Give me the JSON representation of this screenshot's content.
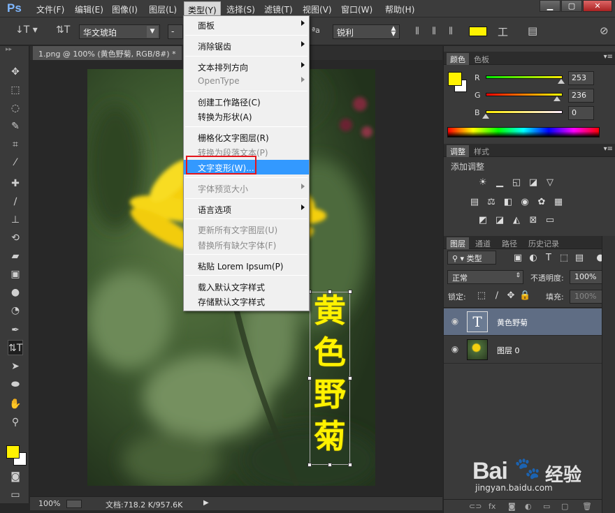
{
  "app": {
    "logo": "Ps"
  },
  "menubar": {
    "items": [
      "文件(F)",
      "编辑(E)",
      "图像(I)",
      "图层(L)",
      "类型(Y)",
      "选择(S)",
      "滤镜(T)",
      "视图(V)",
      "窗口(W)",
      "帮助(H)"
    ],
    "active": "类型(Y)"
  },
  "options": {
    "font_family": "华文琥珀",
    "font_style": "-",
    "aa_label": "ªa",
    "aa_value": "锐利",
    "text_color": "#fff200"
  },
  "document": {
    "tab_title": "1.png @ 100% (黄色野菊, RGB/8#) *",
    "vertical_text": [
      "黄",
      "色",
      "野",
      "菊"
    ]
  },
  "status": {
    "zoom": "100%",
    "doc_info": "文档:718.2 K/957.6K"
  },
  "type_menu": {
    "items": [
      {
        "label": "面板",
        "submenu": true,
        "disabled": false
      },
      {
        "label": "消除锯齿",
        "submenu": true,
        "disabled": false
      },
      {
        "label": "文本排列方向",
        "submenu": true,
        "disabled": false
      },
      {
        "label": "OpenType",
        "submenu": true,
        "disabled": true
      },
      {
        "label": "创建工作路径(C)",
        "submenu": false,
        "disabled": false
      },
      {
        "label": "转换为形状(A)",
        "submenu": false,
        "disabled": false
      },
      {
        "label": "栅格化文字图层(R)",
        "submenu": false,
        "disabled": false
      },
      {
        "label": "转换为段落文本(P)",
        "submenu": false,
        "disabled": true
      },
      {
        "label": "文字变形(W)...",
        "submenu": false,
        "disabled": false,
        "highlighted": true
      },
      {
        "label": "字体预览大小",
        "submenu": true,
        "disabled": true
      },
      {
        "label": "语言选项",
        "submenu": true,
        "disabled": false
      },
      {
        "label": "更新所有文字图层(U)",
        "submenu": false,
        "disabled": true
      },
      {
        "label": "替换所有缺欠字体(F)",
        "submenu": false,
        "disabled": true
      },
      {
        "label": "粘贴 Lorem Ipsum(P)",
        "submenu": false,
        "disabled": false
      },
      {
        "label": "载入默认文字样式",
        "submenu": false,
        "disabled": false
      },
      {
        "label": "存储默认文字样式",
        "submenu": false,
        "disabled": false
      }
    ]
  },
  "color_panel": {
    "tabs": [
      "颜色",
      "色板"
    ],
    "r": 253,
    "g": 236,
    "b": 0,
    "r_label": "R",
    "g_label": "G",
    "b_label": "B"
  },
  "adjust_panel": {
    "tabs": [
      "调整",
      "样式"
    ],
    "title": "添加调整"
  },
  "layers_panel": {
    "tabs": [
      "图层",
      "通道",
      "路径",
      "历史记录"
    ],
    "filter": "类型",
    "blend_mode": "正常",
    "opacity_label": "不透明度:",
    "opacity": "100%",
    "lock_label": "锁定:",
    "fill_label": "填充:",
    "fill": "100%",
    "layers": [
      {
        "name": "黄色野菊",
        "type": "text",
        "selected": true
      },
      {
        "name": "图层 0",
        "type": "image",
        "selected": false
      }
    ]
  },
  "watermark": {
    "brand": "Bai",
    "brand2": "经验",
    "url": "jingyan.baidu.com"
  }
}
